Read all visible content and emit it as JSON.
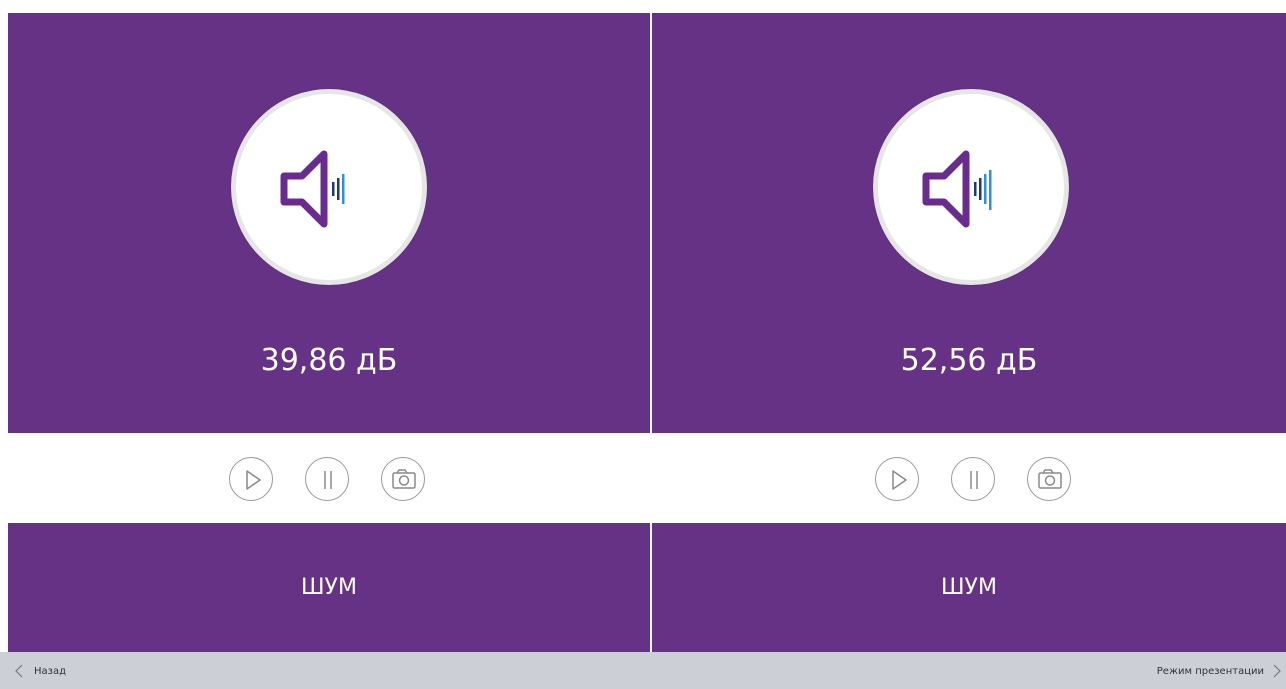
{
  "panels": [
    {
      "reading": "39,86 дБ",
      "label": "ШУМ",
      "level_bars_active": 3
    },
    {
      "reading": "52,56 дБ",
      "label": "ШУМ",
      "level_bars_active": 4
    }
  ],
  "footer": {
    "back_label": "Назад",
    "presentation_label": "Режим презентации"
  },
  "colors": {
    "panel_purple": "#663286",
    "speaker_purple": "#6a2b8f",
    "level_dark_blue": "#1f3a6e",
    "level_light_blue": "#2f8fd8",
    "footer_gray": "#ccd0d6"
  },
  "icons": {
    "speaker": "speaker-icon",
    "play": "play-icon",
    "pause": "pause-icon",
    "camera": "camera-icon",
    "back": "chevron-left-icon",
    "forward": "chevron-right-icon"
  }
}
